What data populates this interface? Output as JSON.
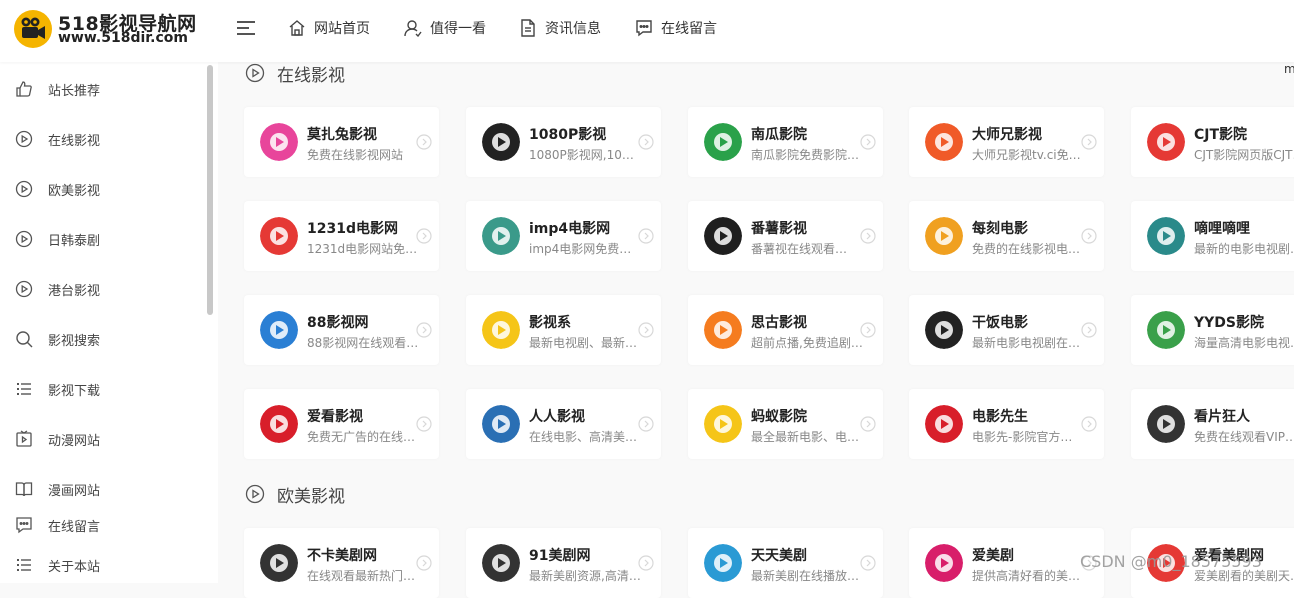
{
  "header": {
    "site_name": "518影视导航网",
    "site_url": "www.518dir.com",
    "nav": [
      {
        "label": "网站首页",
        "icon": "home-icon"
      },
      {
        "label": "值得一看",
        "icon": "user-icon"
      },
      {
        "label": "资讯信息",
        "icon": "document-icon"
      },
      {
        "label": "在线留言",
        "icon": "message-icon"
      }
    ]
  },
  "sidebar": {
    "items": [
      {
        "label": "站长推荐",
        "icon": "thumbs-up-icon"
      },
      {
        "label": "在线影视",
        "icon": "play-circle-icon"
      },
      {
        "label": "欧美影视",
        "icon": "play-circle-icon"
      },
      {
        "label": "日韩泰剧",
        "icon": "play-circle-icon"
      },
      {
        "label": "港台影视",
        "icon": "play-circle-icon"
      },
      {
        "label": "影视搜索",
        "icon": "search-icon"
      },
      {
        "label": "影视下载",
        "icon": "list-icon"
      },
      {
        "label": "动漫网站",
        "icon": "tv-play-icon"
      },
      {
        "label": "漫画网站",
        "icon": "book-icon"
      },
      {
        "label": "在线留言",
        "icon": "message-icon"
      },
      {
        "label": "关于本站",
        "icon": "list-icon"
      }
    ]
  },
  "more_text": "m",
  "sections": [
    {
      "title": "在线影视",
      "cards": [
        {
          "title": "莫扎兔影视",
          "desc": "免费在线影视网站",
          "logo_color": "#e8459b"
        },
        {
          "title": "1080P影视",
          "desc": "1080P影视网,108…",
          "logo_color": "#222222"
        },
        {
          "title": "南瓜影院",
          "desc": "南瓜影院免费影院…",
          "logo_color": "#2aa14a"
        },
        {
          "title": "大师兄影视",
          "desc": "大师兄影视tv.ci免…",
          "logo_color": "#f05a28"
        },
        {
          "title": "CJT影院",
          "desc": "CJT影院网页版CJT…",
          "logo_color": "#e53935"
        },
        {
          "title": "1231d电影网",
          "desc": "1231d电影网站免…",
          "logo_color": "#e53935"
        },
        {
          "title": "imp4电影网",
          "desc": "imp4电影网免费在…",
          "logo_color": "#3a9a8a"
        },
        {
          "title": "番薯影视",
          "desc": "番薯视在线观看…",
          "logo_color": "#1f1f1f"
        },
        {
          "title": "每刻电影",
          "desc": "免费的在线影视电…",
          "logo_color": "#f0a020"
        },
        {
          "title": "嘀哩嘀哩",
          "desc": "最新的电影电视剧…",
          "logo_color": "#2a8a8a"
        },
        {
          "title": "88影视网",
          "desc": "88影视网在线观看…",
          "logo_color": "#2a7fd4"
        },
        {
          "title": "影视系",
          "desc": "最新电视剧、最新…",
          "logo_color": "#f5c518"
        },
        {
          "title": "思古影视",
          "desc": "超前点播,免费追剧,…",
          "logo_color": "#f57c1f"
        },
        {
          "title": "干饭电影",
          "desc": "最新电影电视剧在…",
          "logo_color": "#222222"
        },
        {
          "title": "YYDS影院",
          "desc": "海量高清电影电视…",
          "logo_color": "#3aa04a"
        },
        {
          "title": "爱看影视",
          "desc": "免费无广告的在线…",
          "logo_color": "#d81e2a"
        },
        {
          "title": "人人影视",
          "desc": "在线电影、高清美…",
          "logo_color": "#2a6fb4"
        },
        {
          "title": "蚂蚁影院",
          "desc": "最全最新电影、电…",
          "logo_color": "#f5c518"
        },
        {
          "title": "电影先生",
          "desc": "电影先-影院官方网…",
          "logo_color": "#d81e2a"
        },
        {
          "title": "看片狂人",
          "desc": "免费在线观看VIP…",
          "logo_color": "#333333"
        }
      ]
    },
    {
      "title": "欧美影视",
      "cards": [
        {
          "title": "不卡美剧网",
          "desc": "在线观看最新热门…",
          "logo_color": "#333333"
        },
        {
          "title": "91美剧网",
          "desc": "最新美剧资源,高清…",
          "logo_color": "#333333"
        },
        {
          "title": "天天美剧",
          "desc": "最新美剧在线播放…",
          "logo_color": "#2a9ad4"
        },
        {
          "title": "爱美剧",
          "desc": "提供高清好看的美…",
          "logo_color": "#d81e6a"
        },
        {
          "title": "爱看美剧网",
          "desc": "爱美剧看的美剧天…",
          "logo_color": "#e53935"
        }
      ]
    }
  ],
  "watermark": "CSDN @m0_18575593"
}
